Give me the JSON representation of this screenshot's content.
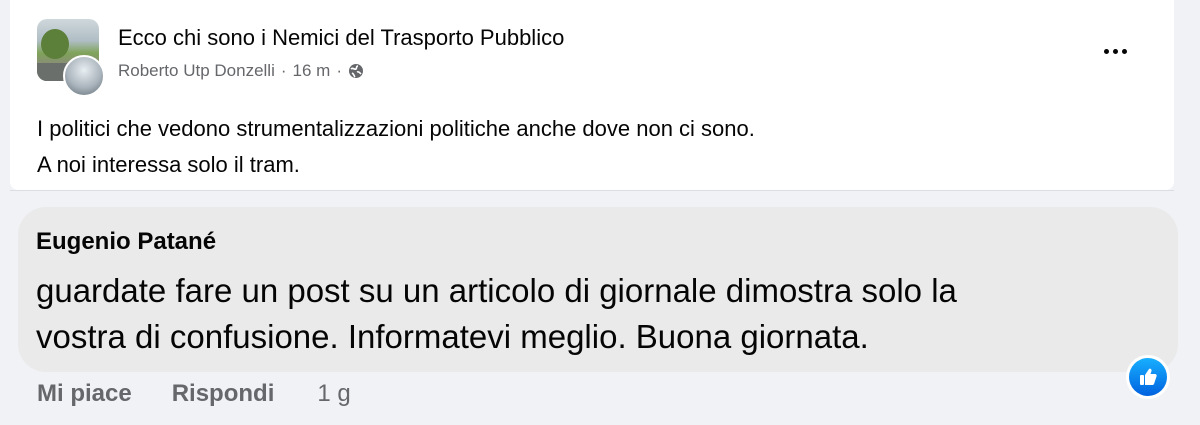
{
  "post": {
    "title": "Ecco chi sono i Nemici del Trasporto Pubblico",
    "author": "Roberto Utp Donzelli",
    "separator": "·",
    "time": "16 m",
    "privacy_icon": "globe-icon",
    "menu_icon": "more-options-icon",
    "body_line1": "I politici che vedono strumentalizzazioni politiche anche dove non ci sono.",
    "body_line2": "A noi interessa solo il tram."
  },
  "comment": {
    "author": "Eugenio Patané",
    "text_line1": "guardate fare un post su un articolo di giornale dimostra solo la",
    "text_line2": "vostra di confusione. Informatevi meglio. Buona giornata.",
    "reaction_icon": "like-icon",
    "reaction_color": "#1877f2"
  },
  "actions": {
    "like_label": "Mi piace",
    "reply_label": "Rispondi",
    "time": "1 g"
  },
  "colors": {
    "background": "#f0f2f5",
    "comment_bubble": "#eaeaea",
    "secondary_text": "#65676b"
  }
}
